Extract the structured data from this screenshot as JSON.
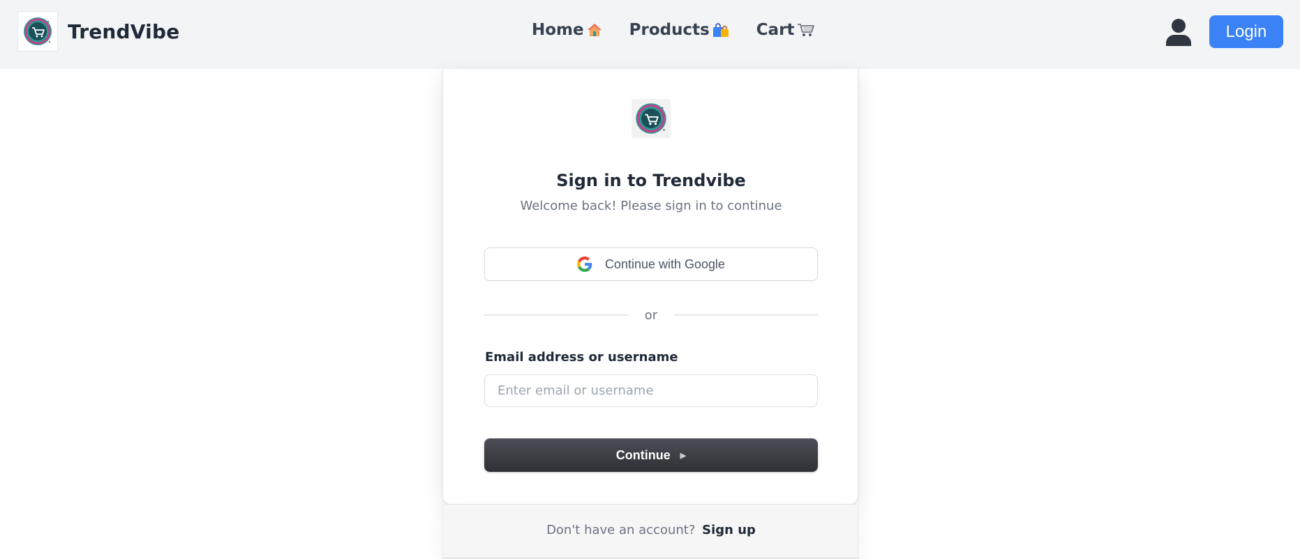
{
  "header": {
    "brand_name": "TrendVibe",
    "nav": [
      {
        "label": "Home",
        "icon": "house-icon"
      },
      {
        "label": "Products",
        "icon": "shopping-bags-icon"
      },
      {
        "label": "Cart",
        "icon": "cart-icon"
      }
    ],
    "login_label": "Login"
  },
  "card": {
    "title": "Sign in to Trendvibe",
    "subtitle": "Welcome back! Please sign in to continue",
    "google_label": "Continue with Google",
    "divider_text": "or",
    "email_label": "Email address or username",
    "email_placeholder": "Enter email or username",
    "email_value": "",
    "continue_label": "Continue"
  },
  "footer": {
    "prompt": "Don't have an account?",
    "signup_label": "Sign up"
  },
  "colors": {
    "accent": "#3b82f6",
    "header_bg": "#f3f4f6",
    "primary_dark": "#2e3035"
  }
}
